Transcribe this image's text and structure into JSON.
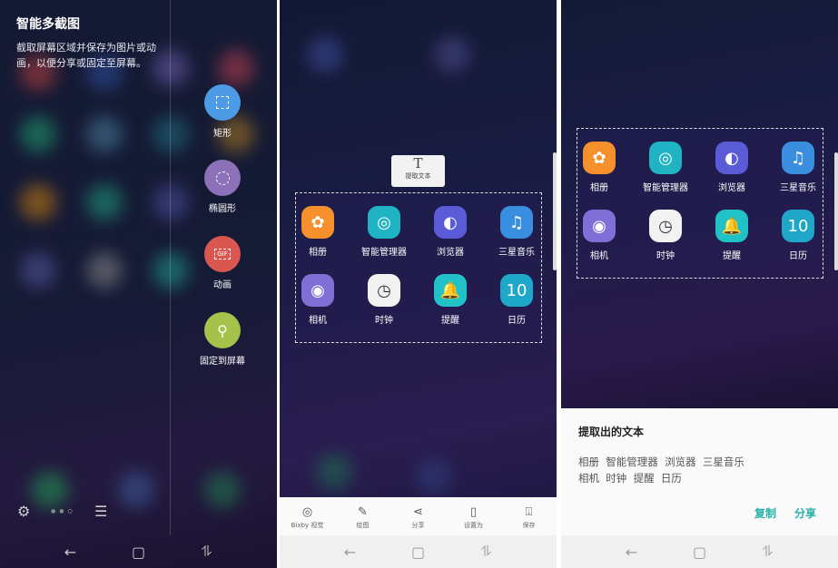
{
  "panel1": {
    "title": "智能多截图",
    "description": "截取屏幕区域并保存为图片或动画，以便分享或固定至屏幕。",
    "modes": [
      {
        "label": "矩形",
        "icon": "rectangle-select-icon",
        "color": "#4e9be5"
      },
      {
        "label": "椭圆形",
        "icon": "oval-select-icon",
        "color": "#8c70b8"
      },
      {
        "label": "动画",
        "icon": "gif-icon",
        "color": "#d9574f",
        "glyph": "GIF"
      },
      {
        "label": "固定到屏幕",
        "icon": "pin-icon",
        "color": "#a5c24a"
      }
    ]
  },
  "apps": [
    {
      "label": "相册",
      "icon": "gallery-icon",
      "color": "#f5902d",
      "glyph": "✿"
    },
    {
      "label": "智能管理器",
      "icon": "smart-manager-icon",
      "color": "#1fb3c4",
      "glyph": "◎"
    },
    {
      "label": "浏览器",
      "icon": "browser-icon",
      "color": "#5a5bd6",
      "glyph": "◐"
    },
    {
      "label": "三星音乐",
      "icon": "music-icon",
      "color": "#3a8ee0",
      "glyph": "♫"
    },
    {
      "label": "相机",
      "icon": "camera-icon",
      "color": "#7f6fd6",
      "glyph": "◉"
    },
    {
      "label": "时钟",
      "icon": "clock-icon",
      "color": "#f2f2f2",
      "glyph": "◷"
    },
    {
      "label": "提醒",
      "icon": "reminder-icon",
      "color": "#20c2c8",
      "glyph": "🔔"
    },
    {
      "label": "日历",
      "icon": "calendar-icon",
      "color": "#1ea7c8",
      "glyph": "10"
    }
  ],
  "panel2": {
    "tooltip": {
      "label": "提取文本",
      "icon": "T"
    },
    "toolbar": [
      {
        "label": "Bixby 视觉",
        "icon": "eye-icon",
        "glyph": "◎"
      },
      {
        "label": "绘图",
        "icon": "pen-icon",
        "glyph": "✎"
      },
      {
        "label": "分享",
        "icon": "share-icon",
        "glyph": "⋖"
      },
      {
        "label": "设置为",
        "icon": "set-as-icon",
        "glyph": "▯"
      },
      {
        "label": "保存",
        "icon": "save-icon",
        "glyph": "⍗"
      }
    ]
  },
  "panel3": {
    "sheet_title": "提取出的文本",
    "line1": "相册  智能管理器  浏览器  三星音乐",
    "line2": "相机  时钟  提醒  日历",
    "copy": "复制",
    "share": "分享",
    "accent": "#23b0a8"
  },
  "nav": {
    "back": "←",
    "home": "▢",
    "recent": "⥮"
  }
}
